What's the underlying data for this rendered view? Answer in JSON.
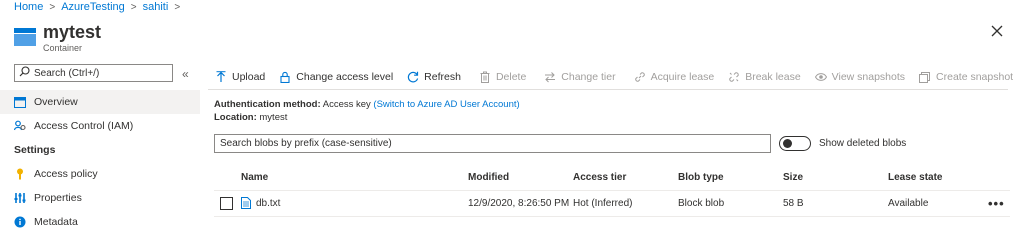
{
  "breadcrumb": {
    "items": [
      "Home",
      "AzureTesting",
      "sahiti"
    ]
  },
  "header": {
    "title": "mytest",
    "subtitle": "Container"
  },
  "sidebar": {
    "search_placeholder": "Search (Ctrl+/)",
    "collapse_glyph": "«",
    "items": [
      {
        "label": "Overview",
        "icon": "container-icon",
        "active": true
      },
      {
        "label": "Access Control (IAM)",
        "icon": "iam-people-icon"
      }
    ],
    "section_label": "Settings",
    "settings_items": [
      {
        "label": "Access policy",
        "icon": "key-icon"
      },
      {
        "label": "Properties",
        "icon": "properties-sliders-icon"
      },
      {
        "label": "Metadata",
        "icon": "info-icon"
      }
    ]
  },
  "toolbar": {
    "upload": "Upload",
    "change_access_level": "Change access level",
    "refresh": "Refresh",
    "delete": "Delete",
    "change_tier": "Change tier",
    "acquire_lease": "Acquire lease",
    "break_lease": "Break lease",
    "view_snapshots": "View snapshots",
    "create_snapshot": "Create snapshot"
  },
  "info": {
    "auth_label": "Authentication method:",
    "auth_value": "Access key",
    "auth_link": "(Switch to Azure AD User Account)",
    "location_label": "Location:",
    "location_value": "mytest"
  },
  "blob_search": {
    "placeholder": "Search blobs by prefix (case-sensitive)"
  },
  "toggle": {
    "label": "Show deleted blobs"
  },
  "table": {
    "columns": [
      "Name",
      "Modified",
      "Access tier",
      "Blob type",
      "Size",
      "Lease state"
    ],
    "rows": [
      {
        "name": "db.txt",
        "modified": "12/9/2020, 8:26:50 PM",
        "access_tier": "Hot (Inferred)",
        "blob_type": "Block blob",
        "size": "58 B",
        "lease_state": "Available"
      }
    ],
    "more_glyph": "•••"
  },
  "colors": {
    "accent": "#0078d4",
    "disabled": "#a19f9d",
    "text": "#323130"
  }
}
